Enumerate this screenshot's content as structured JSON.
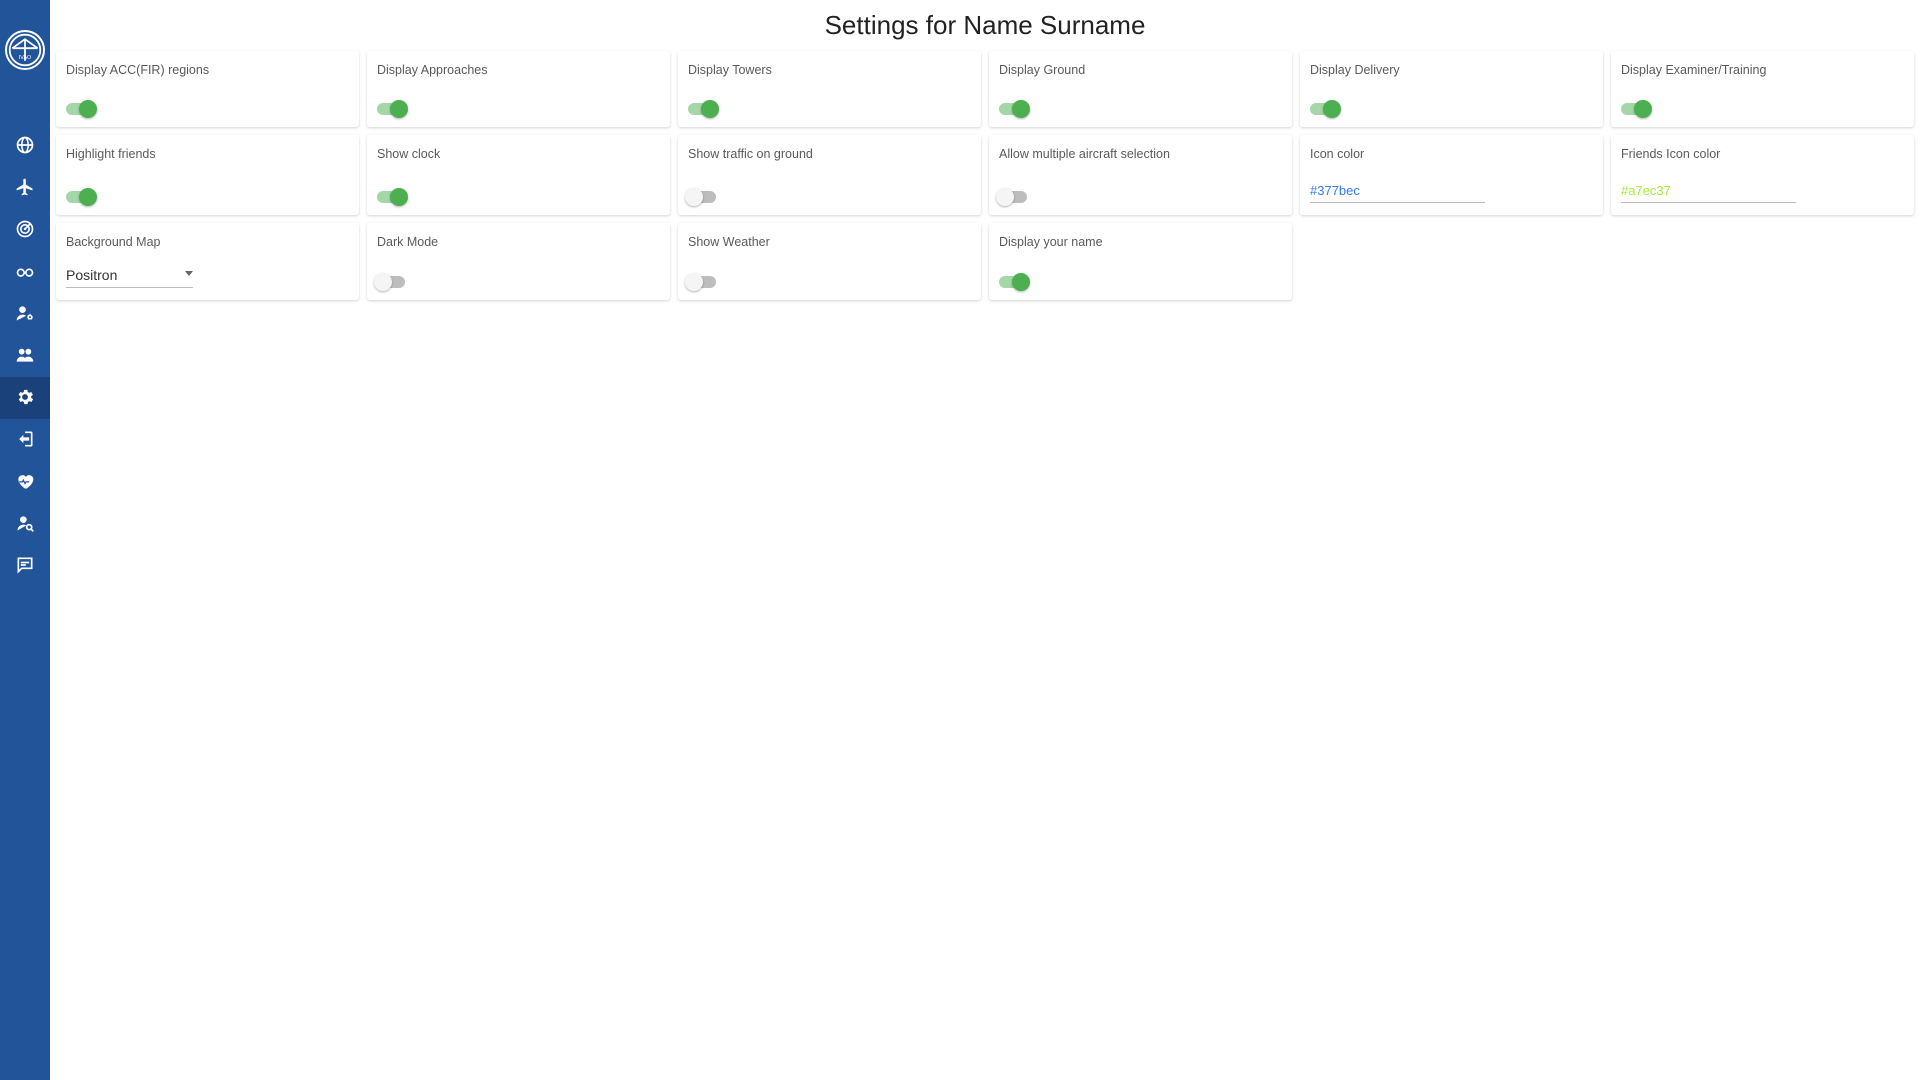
{
  "page_title": "Settings for Name Surname",
  "colors": {
    "sidebar_bg": "#22549a",
    "toggle_on": "#4caf50",
    "toggle_on_track": "#a5d6a7"
  },
  "sidebar": {
    "logo_alt": "IVAO",
    "items": [
      {
        "name": "globe",
        "active": false
      },
      {
        "name": "plane",
        "active": false
      },
      {
        "name": "radar",
        "active": false
      },
      {
        "name": "glasses",
        "active": false
      },
      {
        "name": "user-cog",
        "active": false
      },
      {
        "name": "friends",
        "active": false
      },
      {
        "name": "settings",
        "active": true
      },
      {
        "name": "logout",
        "active": false
      },
      {
        "name": "health",
        "active": false
      },
      {
        "name": "search-user",
        "active": false
      },
      {
        "name": "chat",
        "active": false
      }
    ]
  },
  "cards": [
    {
      "key": "acc_fir",
      "type": "toggle",
      "label": "Display ACC(FIR) regions",
      "value": true
    },
    {
      "key": "appr",
      "type": "toggle",
      "label": "Display Approaches",
      "value": true
    },
    {
      "key": "towers",
      "type": "toggle",
      "label": "Display Towers",
      "value": true
    },
    {
      "key": "ground",
      "type": "toggle",
      "label": "Display Ground",
      "value": true
    },
    {
      "key": "delivery",
      "type": "toggle",
      "label": "Display Delivery",
      "value": true
    },
    {
      "key": "examiner",
      "type": "toggle",
      "label": "Display Examiner/Training",
      "value": true
    },
    {
      "key": "hl_friends",
      "type": "toggle",
      "label": "Highlight friends",
      "value": true
    },
    {
      "key": "clock",
      "type": "toggle",
      "label": "Show clock",
      "value": true
    },
    {
      "key": "traffic",
      "type": "toggle",
      "label": "Show traffic on ground",
      "value": false
    },
    {
      "key": "multi_sel",
      "type": "toggle",
      "label": "Allow multiple aircraft selection",
      "value": false
    },
    {
      "key": "icon_color",
      "type": "text",
      "label": "Icon color",
      "value": "#377bec",
      "text_color": "#377bec"
    },
    {
      "key": "friend_col",
      "type": "text",
      "label": "Friends Icon color",
      "value": "#a7ec37",
      "text_color": "#a7ec37"
    },
    {
      "key": "bg_map",
      "type": "select",
      "label": "Background Map",
      "value": "Positron"
    },
    {
      "key": "dark",
      "type": "toggle",
      "label": "Dark Mode",
      "value": false
    },
    {
      "key": "weather",
      "type": "toggle",
      "label": "Show Weather",
      "value": false
    },
    {
      "key": "your_name",
      "type": "toggle",
      "label": "Display your name",
      "value": true
    }
  ]
}
